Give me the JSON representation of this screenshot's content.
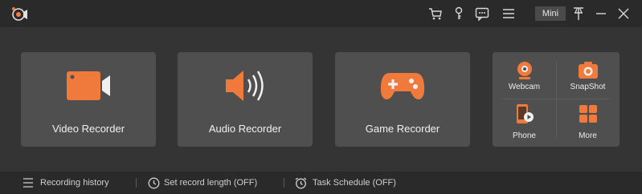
{
  "colors": {
    "accent": "#f07a3c",
    "card": "#4f4f4f",
    "background": "#343434"
  },
  "titlebar": {
    "icons": [
      "logo-icon",
      "cart-icon",
      "key-icon",
      "chat-icon",
      "menu-icon",
      "pin-icon",
      "minimize-icon",
      "close-icon"
    ],
    "mini_label": "Mini"
  },
  "recorders": [
    {
      "label": "Video Recorder",
      "icon": "video-camera-icon"
    },
    {
      "label": "Audio Recorder",
      "icon": "speaker-icon"
    },
    {
      "label": "Game Recorder",
      "icon": "gamepad-icon"
    }
  ],
  "tools": [
    {
      "label": "Webcam",
      "icon": "webcam-icon"
    },
    {
      "label": "SnapShot",
      "icon": "camera-icon"
    },
    {
      "label": "Phone",
      "icon": "phone-icon"
    },
    {
      "label": "More",
      "icon": "grid-icon"
    }
  ],
  "statusbar": {
    "history": "Recording history",
    "length": "Set record length (OFF)",
    "schedule": "Task Schedule (OFF)"
  }
}
